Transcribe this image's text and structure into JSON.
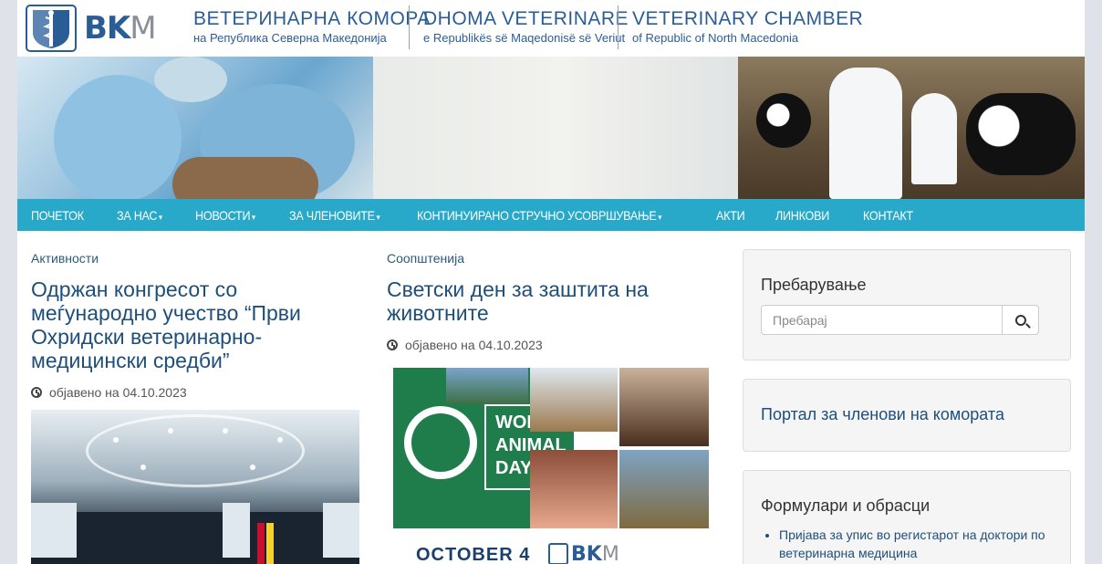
{
  "header": {
    "logo_text": "BK",
    "logo_text_m": "M",
    "mk_title": "ВЕТЕРИНАРНА КОМОРА",
    "mk_subtitle": "на Република Северна Македонија",
    "al_title": "DHOMA VETERINARE",
    "al_subtitle": "e Republikës së Maqedonisë së Veriut",
    "en_title": "VETERINARY CHAMBER",
    "en_subtitle": "of Republic of North Macedonia"
  },
  "nav": {
    "items": [
      {
        "label": "ПОЧЕТОК",
        "dropdown": false
      },
      {
        "label": "ЗА НАС",
        "dropdown": true
      },
      {
        "label": "НОВОСТИ",
        "dropdown": true
      },
      {
        "label": "ЗА ЧЛЕНОВИТЕ",
        "dropdown": true
      },
      {
        "label": "КОНТИНУИРАНО СТРУЧНО УСОВРШУВАЊЕ",
        "dropdown": true
      },
      {
        "label": "АКТИ",
        "dropdown": false
      },
      {
        "label": "ЛИНКОВИ",
        "dropdown": false
      },
      {
        "label": "КОНТАКТ",
        "dropdown": false
      }
    ],
    "caret": "▾",
    "bar_color": "#29a9c9"
  },
  "posts": [
    {
      "category": "Активности",
      "title": "Одржан конгресот со меѓународно учество “Први Охридски ветеринарно-медицински средби”",
      "date_label": "објавено на 04.10.2023"
    },
    {
      "category": "Соопштенија",
      "title": "Светски ден за заштита на животните",
      "date_label": "објавено на 04.10.2023",
      "image_text": {
        "line1": "WORLD",
        "line2": "ANIMAL",
        "line3": "DAY",
        "bottom": "OCTOBER 4",
        "logo_bk": "BK",
        "logo_m": "M"
      }
    }
  ],
  "sidebar": {
    "search_title": "Пребарување",
    "search_placeholder": "Пребарај",
    "portal_link": "Портал за членови на комората",
    "forms_title": "Формулари и обрасци",
    "forms": [
      "Пријава за упис во регистарот на доктори по ветеринарна медицина"
    ]
  },
  "colors": {
    "brand_blue": "#2a5d96",
    "title_blue": "#1e4f7a",
    "nav_teal": "#29a9c9",
    "wad_green": "#1e7d4a"
  }
}
